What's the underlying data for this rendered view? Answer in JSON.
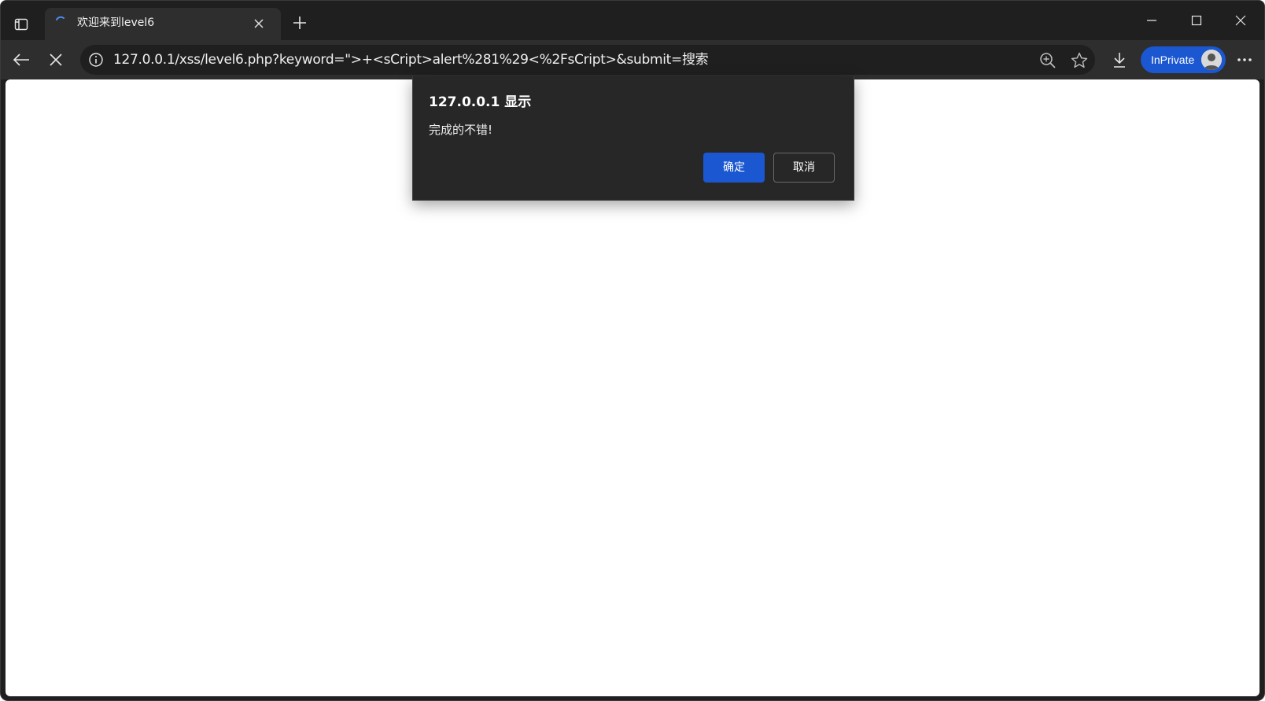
{
  "tab": {
    "title": "欢迎来到level6"
  },
  "address_bar": {
    "url": "127.0.0.1/xss/level6.php?keyword=\">+<sCript>alert%281%29<%2FsCript>&submit=搜索"
  },
  "profile": {
    "label": "InPrivate"
  },
  "dialog": {
    "title": "127.0.0.1 显示",
    "message": "完成的不错!",
    "ok_label": "确定",
    "cancel_label": "取消"
  },
  "colors": {
    "accent": "#1b57d0",
    "chrome_dark": "#1f1f1f",
    "toolbar": "#2e2e2e",
    "dialog_bg": "#272727"
  }
}
